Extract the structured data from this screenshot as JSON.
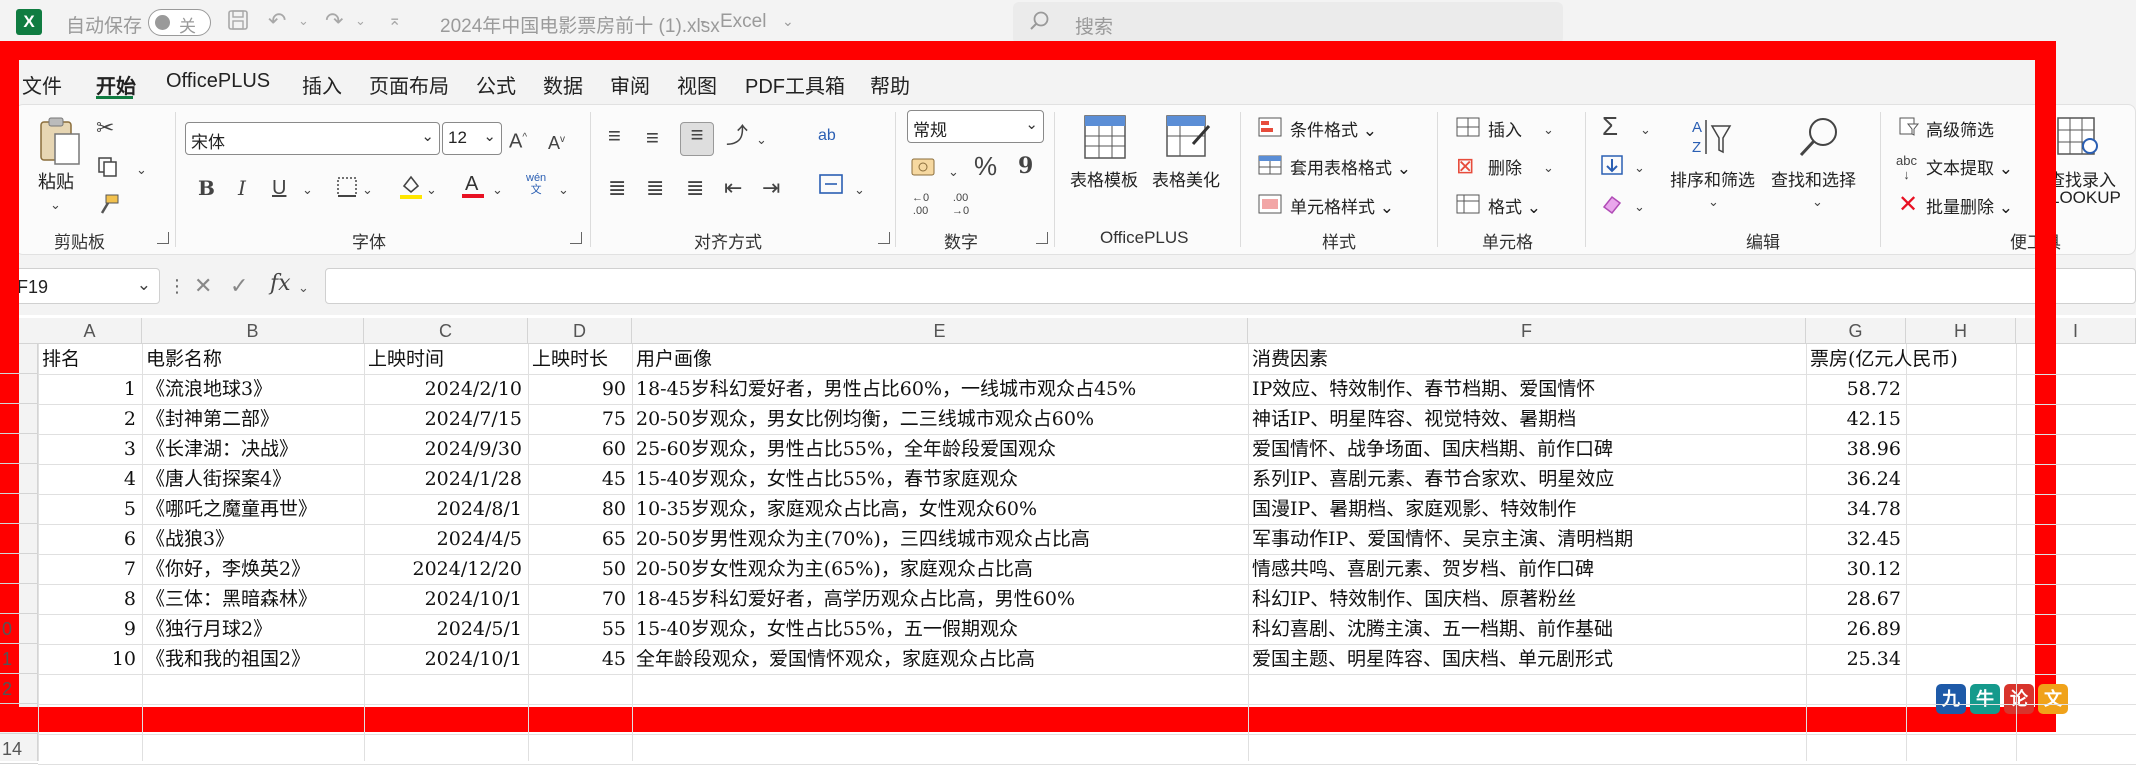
{
  "titlebar": {
    "logo_letter": "X",
    "autosave_label": "自动保存",
    "autosave_state": "关",
    "filename": "2024年中国电影票房前十 (1).xlsx",
    "app_name": "Excel",
    "search_placeholder": "搜索"
  },
  "tabs": [
    "文件",
    "开始",
    "OfficePLUS",
    "插入",
    "页面布局",
    "公式",
    "数据",
    "审阅",
    "视图",
    "PDF工具箱",
    "帮助"
  ],
  "active_tab": "开始",
  "ribbon": {
    "clipboard": {
      "paste": "粘贴",
      "group": "剪贴板"
    },
    "font": {
      "name": "宋体",
      "size": "12",
      "bold": "B",
      "italic": "I",
      "underline": "U",
      "phonetic": "wén",
      "group": "字体"
    },
    "alignment": {
      "group": "对齐方式"
    },
    "number": {
      "format": "常规",
      "percent": "%",
      "comma": "9",
      "inc_dec": ".00",
      "group": "数字"
    },
    "officeplus": {
      "table_template": "表格模板",
      "table_beautify": "表格美化",
      "group": "OfficePLUS"
    },
    "styles": {
      "conditional": "条件格式",
      "table_format": "套用表格格式",
      "cell_style": "单元格样式",
      "group": "样式"
    },
    "cells": {
      "insert": "插入",
      "delete": "删除",
      "format": "格式",
      "group": "单元格"
    },
    "editing": {
      "sort_filter": "排序和筛选",
      "find_select": "查找和选择",
      "group": "编辑"
    },
    "tools": {
      "advanced_filter": "高级筛选",
      "text_extract": "文本提取",
      "batch_delete": "批量删除",
      "lookup_1": "查找录入",
      "lookup_2": "LOOKUP",
      "group": "便工具"
    }
  },
  "formula_bar": {
    "name_box": "F19",
    "fx": "fx",
    "content": ""
  },
  "columns": [
    "A",
    "B",
    "C",
    "D",
    "E",
    "F",
    "G",
    "H",
    "I"
  ],
  "row_numbers": [
    "",
    "",
    "",
    "",
    "",
    "",
    "",
    "",
    "",
    "0",
    "1",
    "2",
    "",
    "14"
  ],
  "sheet": {
    "headers": [
      "排名",
      "电影名称",
      "上映时间",
      "上映时长",
      "用户画像",
      "消费因素",
      "票房(亿元人民币)"
    ],
    "rows": [
      [
        "1",
        "《流浪地球3》",
        "2024/2/10",
        "90",
        "18-45岁科幻爱好者，男性占比60%，一线城市观众占45%",
        "IP效应、特效制作、春节档期、爱国情怀",
        "58.72"
      ],
      [
        "2",
        "《封神第二部》",
        "2024/7/15",
        "75",
        "20-50岁观众，男女比例均衡，二三线城市观众占60%",
        "神话IP、明星阵容、视觉特效、暑期档",
        "42.15"
      ],
      [
        "3",
        "《长津湖：决战》",
        "2024/9/30",
        "60",
        "25-60岁观众，男性占比55%，全年龄段爱国观众",
        "爱国情怀、战争场面、国庆档期、前作口碑",
        "38.96"
      ],
      [
        "4",
        "《唐人街探案4》",
        "2024/1/28",
        "45",
        "15-40岁观众，女性占比55%，春节家庭观众",
        "系列IP、喜剧元素、春节合家欢、明星效应",
        "36.24"
      ],
      [
        "5",
        "《哪吒之魔童再世》",
        "2024/8/1",
        "80",
        "10-35岁观众，家庭观众占比高，女性观众60%",
        "国漫IP、暑期档、家庭观影、特效制作",
        "34.78"
      ],
      [
        "6",
        "《战狼3》",
        "2024/4/5",
        "65",
        "20-50岁男性观众为主(70%)，三四线城市观众占比高",
        "军事动作IP、爱国情怀、吴京主演、清明档期",
        "32.45"
      ],
      [
        "7",
        "《你好，李焕英2》",
        "2024/12/20",
        "50",
        "20-50岁女性观众为主(65%)，家庭观众占比高",
        "情感共鸣、喜剧元素、贺岁档、前作口碑",
        "30.12"
      ],
      [
        "8",
        "《三体：黑暗森林》",
        "2024/10/1",
        "70",
        "18-45岁科幻爱好者，高学历观众占比高，男性60%",
        "科幻IP、特效制作、国庆档、原著粉丝",
        "28.67"
      ],
      [
        "9",
        "《独行月球2》",
        "2024/5/1",
        "55",
        "15-40岁观众，女性占比55%，五一假期观众",
        "科幻喜剧、沈腾主演、五一档期、前作基础",
        "26.89"
      ],
      [
        "10",
        "《我和我的祖国2》",
        "2024/10/1",
        "45",
        "全年龄段观众，爱国情怀观众，家庭观众占比高",
        "爱国主题、明星阵容、国庆档、单元剧形式",
        "25.34"
      ]
    ]
  },
  "watermark": [
    "九",
    "牛",
    "论",
    "文"
  ],
  "colors": {
    "excel_green": "#107c41",
    "frame_red": "#ff0000"
  }
}
